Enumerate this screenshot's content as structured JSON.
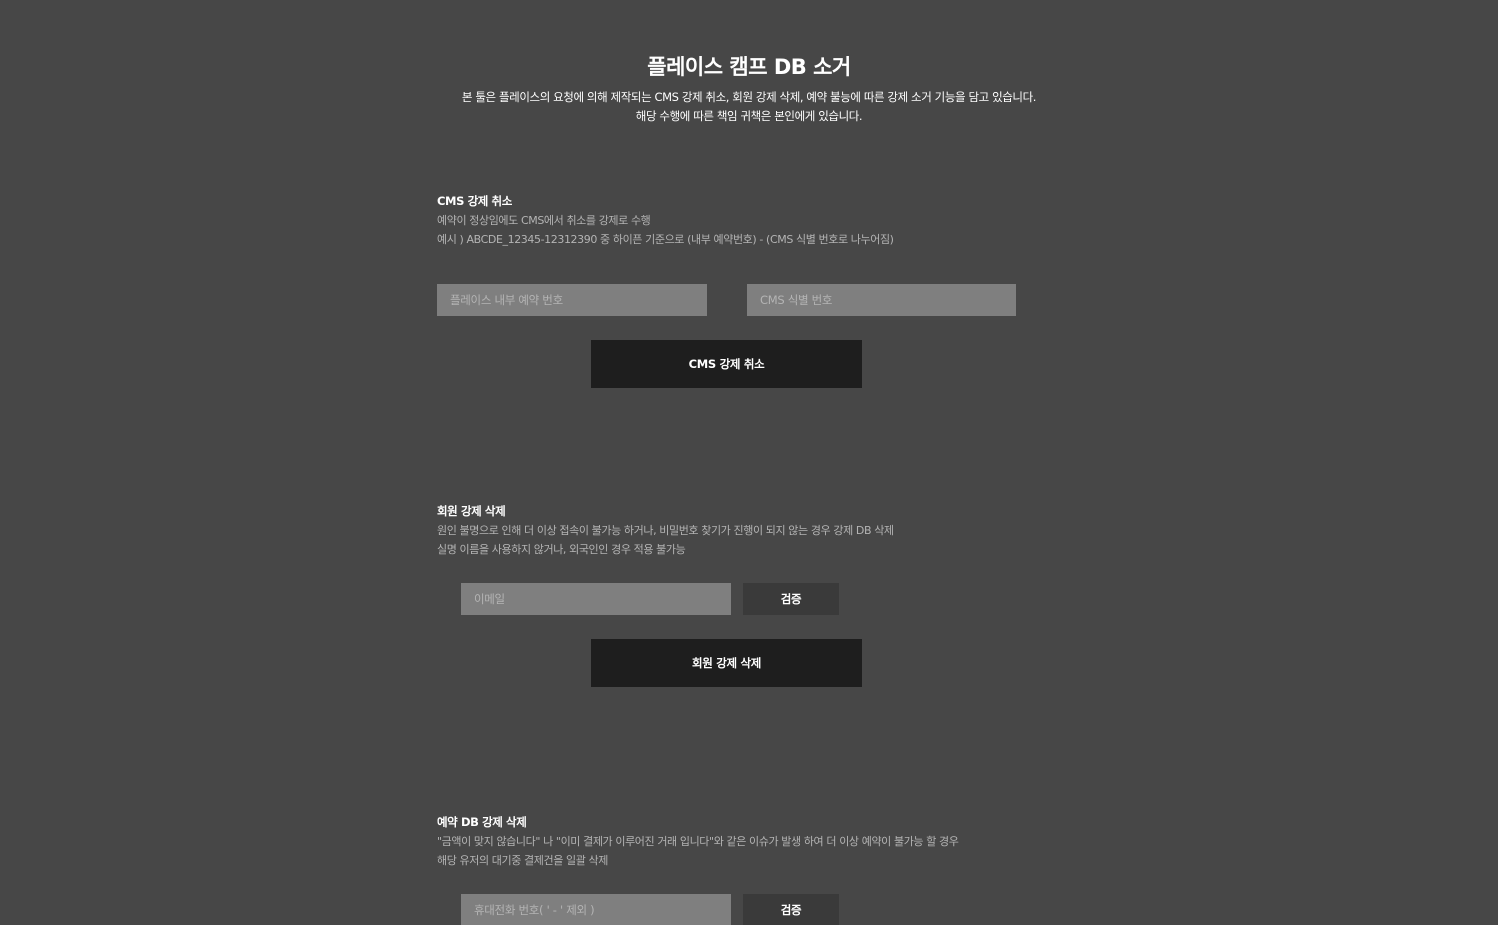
{
  "header": {
    "title": "플레이스 캠프 DB 소거",
    "desc_line1": "본 툴은 플레이스의 요청에 의해 제작되는 CMS 강제 취소, 회원 강제 삭제, 예약 불능에 따른 강제 소거 기능을 담고 있습니다.",
    "desc_line2": "해당 수행에 따른 책임 귀책은 본인에게 있습니다."
  },
  "cms_cancel": {
    "title": "CMS 강제 취소",
    "desc_line1": "예약이 정상임에도 CMS에서 취소를 강제로 수행",
    "desc_line2": "예시 ) ABCDE_12345-12312390 중 하이픈 기준으로 (내부 예약번호) - (CMS 식별 번호로 나누어짐)",
    "reservation_placeholder": "플레이스 내부 예약 번호",
    "reservation_value": "",
    "cms_id_placeholder": "CMS 식별 번호",
    "cms_id_value": "",
    "submit_label": "CMS 강제 취소"
  },
  "member_delete": {
    "title": "회원 강제 삭제",
    "desc_line1": "원인 불명으로 인해 더 이상 접속이 불가능 하거나, 비밀번호 찾기가 진행이 되지 않는 경우 강제 DB 삭제",
    "desc_line2": "실명 이름을 사용하지 않거나, 외국인인 경우 적용 불가능",
    "email_placeholder": "이메일",
    "email_value": "",
    "verify_label": "검증",
    "submit_label": "회원 강제 삭제"
  },
  "reservation_delete": {
    "title": "예약 DB 강제 삭제",
    "desc_line1": "\"금액이 맞지 않습니다\" 나 \"이미 결제가 이루어진 거래 입니다\"와 같은 이슈가 발생 하여 더 이상 예약이 불가능 할 경우",
    "desc_line2": "해당 유저의 대기중 결제건을 일괄 삭제",
    "phone_placeholder": "휴대전화 번호( ' - ' 제외 )",
    "phone_value": "",
    "verify_label": "검증"
  }
}
